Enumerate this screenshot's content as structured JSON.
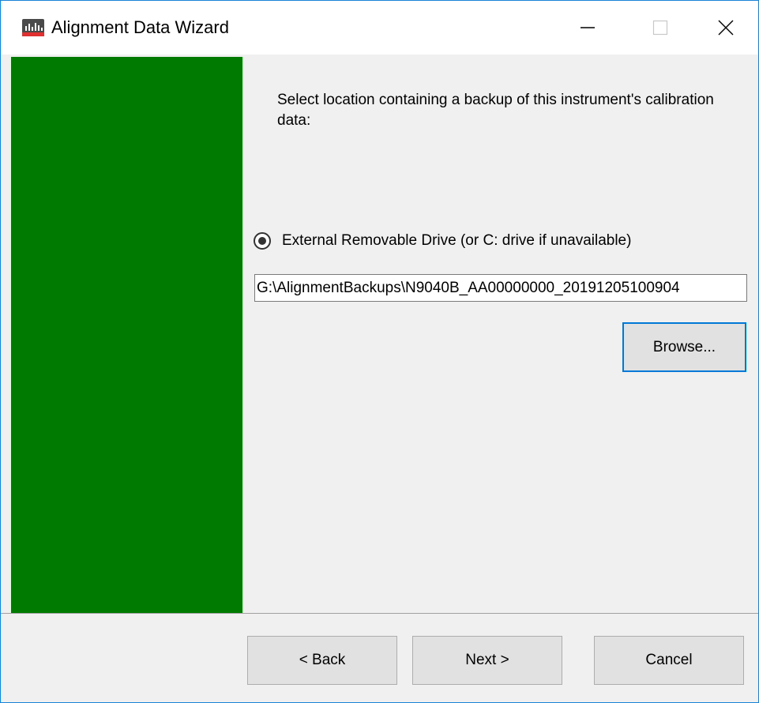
{
  "window": {
    "title": "Alignment Data Wizard",
    "icon": "keysight-app-icon",
    "controls": {
      "minimize": "minimize-icon",
      "maximize": "maximize-icon",
      "close": "close-icon"
    }
  },
  "colors": {
    "side_panel": "#007a00",
    "window_border": "#1883d7",
    "focus_border": "#0078d7",
    "button_face": "#e1e1e1",
    "dialog_bg": "#f0f0f0"
  },
  "content": {
    "instruction": "Select location containing a backup of this instrument's calibration data:",
    "radio_option": {
      "label": "External Removable Drive (or C: drive if unavailable)",
      "selected": true
    },
    "path_value": "G:\\AlignmentBackups\\N9040B_AA00000000_20191205100904",
    "browse_label": "Browse..."
  },
  "footer": {
    "back_label": "< Back",
    "next_label": "Next >",
    "cancel_label": "Cancel"
  }
}
